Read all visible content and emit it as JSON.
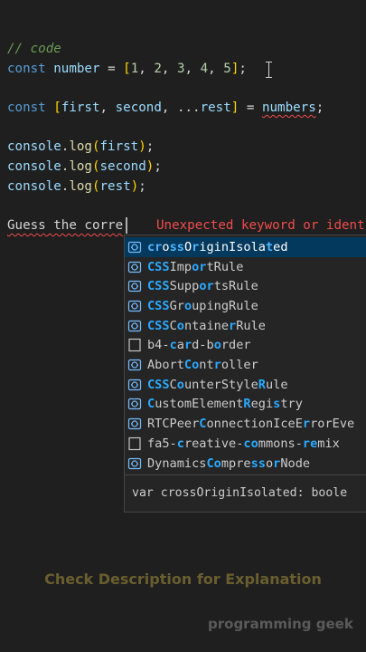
{
  "code": {
    "line1": "// code",
    "line2": {
      "kw": "const",
      "name": "number",
      "eq": "=",
      "open": "[",
      "values": [
        "1",
        "2",
        "3",
        "4",
        "5"
      ],
      "close": "]",
      "semi": ";"
    },
    "line3": {
      "kw": "const",
      "open": "[",
      "first": "first",
      "second": "second",
      "spread": "...",
      "rest": "rest",
      "close": "]",
      "eq": "=",
      "source": "numbers",
      "semi": ";"
    },
    "logs": [
      {
        "obj": "console",
        "fn": "log",
        "arg": "first"
      },
      {
        "obj": "console",
        "fn": "log",
        "arg": "second"
      },
      {
        "obj": "console",
        "fn": "log",
        "arg": "rest"
      }
    ]
  },
  "typing": {
    "text": "Guess the corre",
    "error": "Unexpected keyword or ident"
  },
  "suggest": {
    "items": [
      {
        "icon": "variable",
        "pre": "",
        "parts": [
          [
            "m",
            "cr"
          ],
          [
            "",
            "o"
          ],
          [
            "m",
            "ss"
          ],
          [
            "",
            "O"
          ],
          [
            "m",
            "r"
          ],
          [
            "",
            "iginIsola"
          ],
          [
            "m",
            "t"
          ],
          [
            "",
            "ed"
          ]
        ]
      },
      {
        "icon": "variable",
        "parts": [
          [
            "m",
            "CSS"
          ],
          [
            "",
            "Imp"
          ],
          [
            "m",
            "or"
          ],
          [
            "",
            "tRule"
          ]
        ]
      },
      {
        "icon": "variable",
        "parts": [
          [
            "m",
            "CSS"
          ],
          [
            "",
            "Supp"
          ],
          [
            "m",
            "or"
          ],
          [
            "",
            "tsRule"
          ]
        ]
      },
      {
        "icon": "variable",
        "parts": [
          [
            "m",
            "CSS"
          ],
          [
            "",
            "Gr"
          ],
          [
            "m",
            "o"
          ],
          [
            "",
            "upingRule"
          ]
        ]
      },
      {
        "icon": "variable",
        "parts": [
          [
            "m",
            "CSS"
          ],
          [
            "",
            "C"
          ],
          [
            "m",
            "o"
          ],
          [
            "",
            "ntaine"
          ],
          [
            "m",
            "r"
          ],
          [
            "",
            "Rule"
          ]
        ]
      },
      {
        "icon": "text",
        "parts": [
          [
            "",
            "b4-"
          ],
          [
            "m",
            "c"
          ],
          [
            "",
            "a"
          ],
          [
            "m",
            "r"
          ],
          [
            "",
            "d-b"
          ],
          [
            "m",
            "o"
          ],
          [
            "",
            "rder"
          ]
        ]
      },
      {
        "icon": "variable",
        "parts": [
          [
            "",
            "Abort"
          ],
          [
            "m",
            "Co"
          ],
          [
            "",
            "nt"
          ],
          [
            "m",
            "r"
          ],
          [
            "",
            "oller"
          ]
        ]
      },
      {
        "icon": "variable",
        "parts": [
          [
            "m",
            "CSS"
          ],
          [
            "",
            "C"
          ],
          [
            "m",
            "o"
          ],
          [
            "",
            "unterStyle"
          ],
          [
            "m",
            "R"
          ],
          [
            "",
            "ule"
          ]
        ]
      },
      {
        "icon": "variable",
        "parts": [
          [
            "m",
            "C"
          ],
          [
            "",
            "ustomElement"
          ],
          [
            "m",
            "R"
          ],
          [
            "",
            "egi"
          ],
          [
            "m",
            "s"
          ],
          [
            "",
            "try"
          ]
        ]
      },
      {
        "icon": "variable",
        "parts": [
          [
            "",
            "RTCPeer"
          ],
          [
            "m",
            "C"
          ],
          [
            "",
            "onnectionIceE"
          ],
          [
            "m",
            "r"
          ],
          [
            "",
            "rorEve"
          ]
        ]
      },
      {
        "icon": "text",
        "parts": [
          [
            "",
            "fa5-"
          ],
          [
            "m",
            "c"
          ],
          [
            "",
            "reative-"
          ],
          [
            "m",
            "co"
          ],
          [
            "",
            "mmons-"
          ],
          [
            "m",
            "re"
          ],
          [
            "",
            "mix"
          ]
        ]
      },
      {
        "icon": "variable",
        "parts": [
          [
            "",
            "Dynamics"
          ],
          [
            "m",
            "Co"
          ],
          [
            "",
            "mpre"
          ],
          [
            "m",
            "ss"
          ],
          [
            "",
            "o"
          ],
          [
            "m",
            "r"
          ],
          [
            "",
            "Node"
          ]
        ]
      }
    ],
    "detail": "var crossOriginIsolated: boole"
  },
  "caption": "Check Description for Explanation",
  "watermark": "programming geek"
}
